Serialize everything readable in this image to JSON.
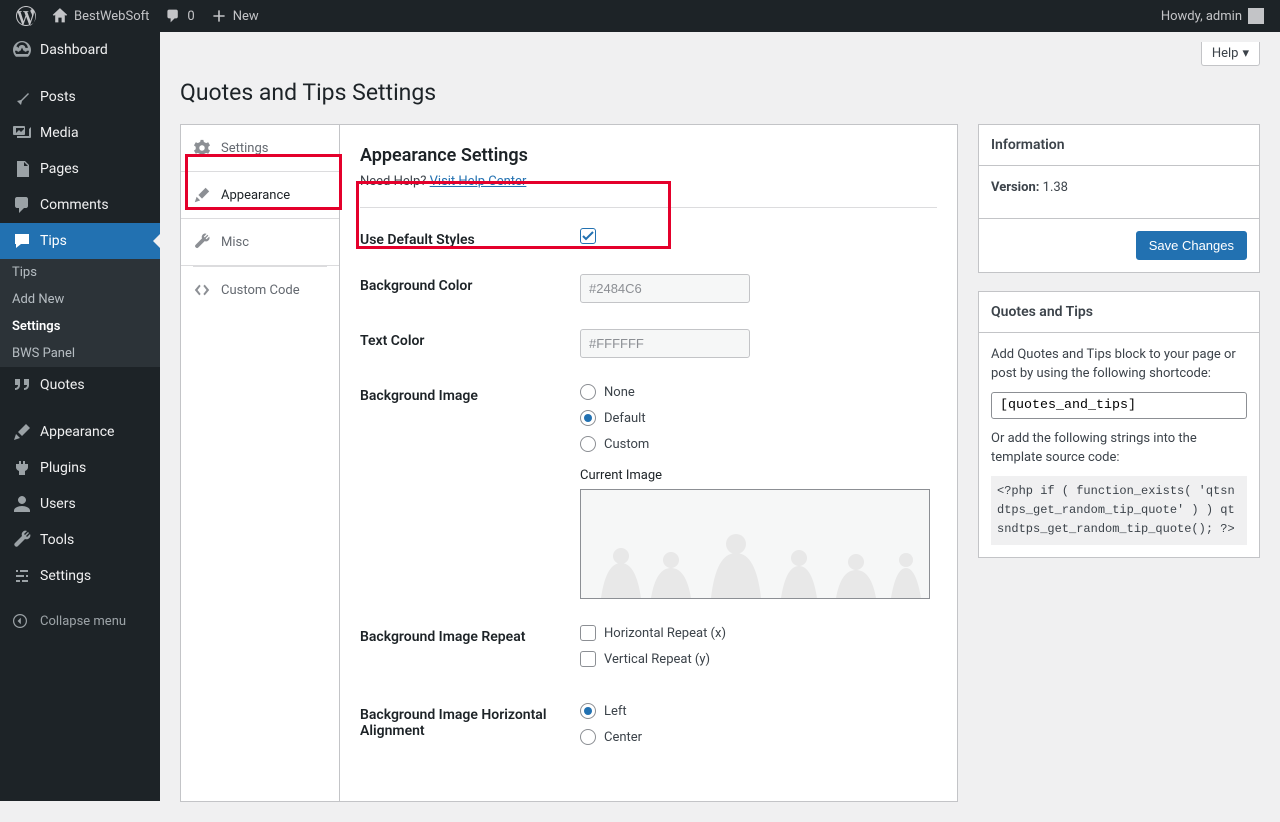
{
  "adminbar": {
    "site_name": "BestWebSoft",
    "comments_count": "0",
    "new_label": "New",
    "howdy": "Howdy, admin"
  },
  "sidebar": {
    "dashboard": "Dashboard",
    "posts": "Posts",
    "media": "Media",
    "pages": "Pages",
    "comments": "Comments",
    "tips": "Tips",
    "sub_tips": "Tips",
    "sub_add_new": "Add New",
    "sub_settings": "Settings",
    "sub_bws_panel": "BWS Panel",
    "quotes": "Quotes",
    "appearance": "Appearance",
    "plugins": "Plugins",
    "users": "Users",
    "tools": "Tools",
    "settings": "Settings",
    "collapse": "Collapse menu"
  },
  "page": {
    "help": "Help",
    "title": "Quotes and Tips Settings"
  },
  "tabs": {
    "settings": "Settings",
    "appearance": "Appearance",
    "misc": "Misc",
    "custom_code": "Custom Code"
  },
  "form": {
    "section_title": "Appearance Settings",
    "need_help": "Need Help?",
    "help_link": "Visit Help Center",
    "use_default_styles": "Use Default Styles",
    "background_color": "Background Color",
    "bg_color_val": "#2484C6",
    "text_color": "Text Color",
    "text_color_val": "#FFFFFF",
    "background_image": "Background Image",
    "bgimg_none": "None",
    "bgimg_default": "Default",
    "bgimg_custom": "Custom",
    "current_image": "Current Image",
    "bg_repeat": "Background Image Repeat",
    "repeat_h": "Horizontal Repeat (x)",
    "repeat_v": "Vertical Repeat (y)",
    "bg_align_h": "Background Image Horizontal Alignment",
    "align_left": "Left",
    "align_center": "Center"
  },
  "sidebox_info": {
    "title": "Information",
    "version_label": "Version:",
    "version_value": "1.38",
    "save": "Save Changes"
  },
  "sidebox_qt": {
    "title": "Quotes and Tips",
    "intro": "Add Quotes and Tips block to your page or post by using the following shortcode:",
    "shortcode": "[quotes_and_tips]",
    "or_text": "Or add the following strings into the template source code:",
    "php_code": "<?php if ( function_exists( 'qtsndtps_get_random_tip_quote' ) ) qtsndtps_get_random_tip_quote(); ?>"
  }
}
